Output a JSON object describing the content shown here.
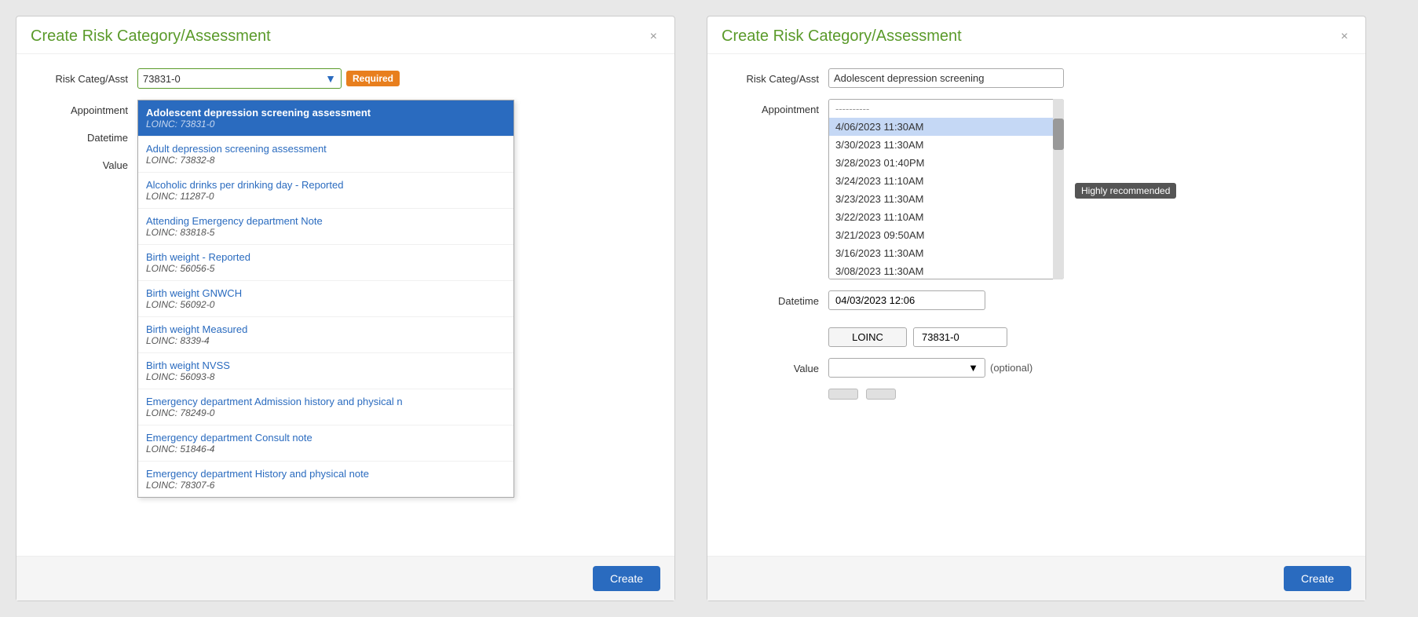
{
  "left_dialog": {
    "title": "Create Risk Category/Assessment",
    "close_label": "×",
    "form": {
      "risk_label": "Risk Categ/Asst",
      "appointment_label": "Appointment",
      "datetime_label": "Datetime",
      "value_label": "Value",
      "input_value": "73831-0",
      "required_badge": "Required"
    },
    "dropdown_items": [
      {
        "name": "Adolescent depression screening assessment",
        "loinc": "LOINC: 73831-0",
        "selected": true
      },
      {
        "name": "Adult depression screening assessment",
        "loinc": "LOINC: 73832-8",
        "selected": false
      },
      {
        "name": "Alcoholic drinks per drinking day - Reported",
        "loinc": "LOINC: 11287-0",
        "selected": false
      },
      {
        "name": "Attending Emergency department Note",
        "loinc": "LOINC: 83818-5",
        "selected": false
      },
      {
        "name": "Birth weight - Reported",
        "loinc": "LOINC: 56056-5",
        "selected": false
      },
      {
        "name": "Birth weight GNWCH",
        "loinc": "LOINC: 56092-0",
        "selected": false
      },
      {
        "name": "Birth weight Measured",
        "loinc": "LOINC: 8339-4",
        "selected": false
      },
      {
        "name": "Birth weight NVSS",
        "loinc": "LOINC: 56093-8",
        "selected": false
      },
      {
        "name": "Emergency department Admission history and physical n",
        "loinc": "LOINC: 78249-0",
        "selected": false
      },
      {
        "name": "Emergency department Consult note",
        "loinc": "LOINC: 51846-4",
        "selected": false
      },
      {
        "name": "Emergency department History and physical note",
        "loinc": "LOINC: 78307-6",
        "selected": false
      }
    ],
    "create_button": "Create"
  },
  "right_dialog": {
    "title": "Create Risk Category/Assessment",
    "close_label": "×",
    "form": {
      "risk_label": "Risk Categ/Asst",
      "appointment_label": "Appointment",
      "datetime_label": "Datetime",
      "value_label": "Value",
      "risk_value": "Adolescent depression screening",
      "datetime_value": "04/03/2023 12:06",
      "loinc_label": "LOINC",
      "loinc_value": "73831-0",
      "optional_text": "(optional)"
    },
    "appointment_options": [
      {
        "value": "----------",
        "empty": true,
        "selected": false
      },
      {
        "value": "4/06/2023 11:30AM",
        "selected": true
      },
      {
        "value": "3/30/2023 11:30AM",
        "selected": false
      },
      {
        "value": "3/28/2023 01:40PM",
        "selected": false
      },
      {
        "value": "3/24/2023 11:10AM",
        "selected": false
      },
      {
        "value": "3/23/2023 11:30AM",
        "selected": false
      },
      {
        "value": "3/22/2023 11:10AM",
        "selected": false
      },
      {
        "value": "3/21/2023 09:50AM",
        "selected": false
      },
      {
        "value": "3/16/2023 11:30AM",
        "selected": false
      },
      {
        "value": "3/08/2023 11:30AM",
        "selected": false
      }
    ],
    "highly_recommended_badge": "Highly recommended",
    "create_button": "Create"
  }
}
